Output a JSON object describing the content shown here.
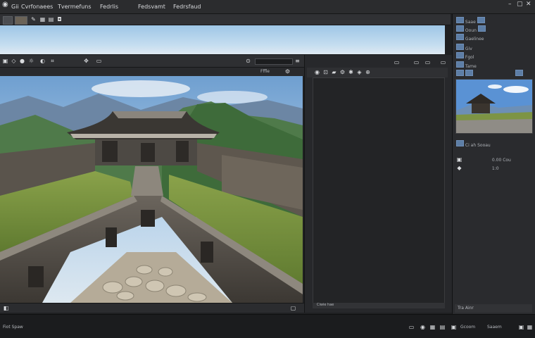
{
  "menubar": {
    "items": [
      "Gii",
      "Cvrfonaees",
      "Tvermefuns",
      "Fedrlis",
      "Fedsvamt",
      "Fedrsfaud"
    ]
  },
  "viewport_toolbar": {
    "field_value": "Fffle"
  },
  "middle_panel": {
    "footer_label": "Ciwie hae"
  },
  "right_panel": {
    "rows": [
      "Saae",
      "Ooun",
      "Gaelinee",
      "Giv",
      "Fgol",
      "Tame"
    ],
    "section2": [
      "Ci ah",
      "Sooau"
    ],
    "lower_label": "Tra Ainr",
    "values": [
      "0.00 Cou",
      "1:0"
    ]
  },
  "statusbar": {
    "left": "Fiot Spaw",
    "right_items": [
      "Gcoom",
      "Saaem"
    ]
  },
  "colors": {
    "panel": "#27282b",
    "accent": "#5d7ea6",
    "sky": "#9ec6e6"
  }
}
